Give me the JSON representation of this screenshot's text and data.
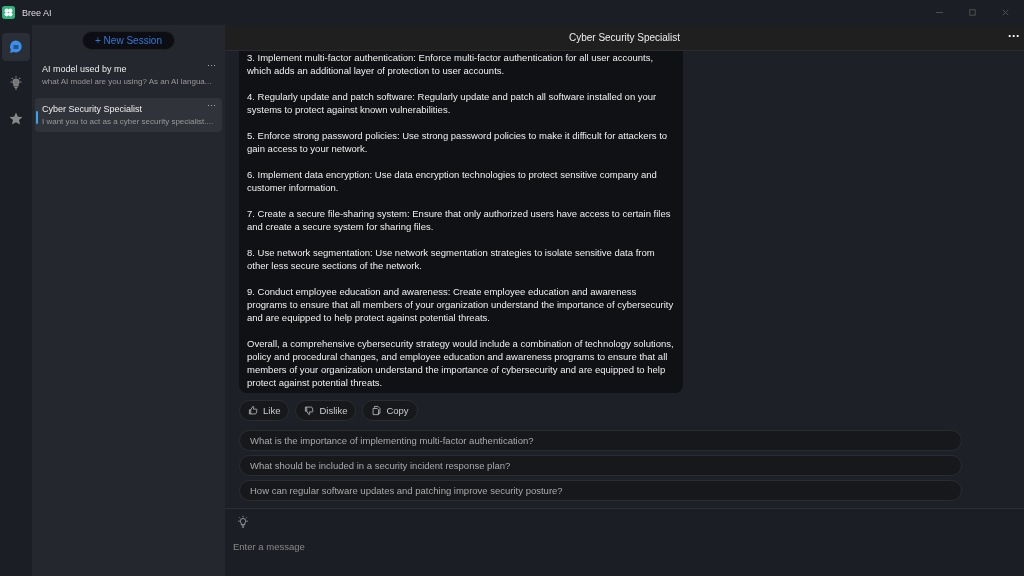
{
  "window": {
    "title": "Bree AI"
  },
  "rail": [
    {
      "kind": "chat",
      "selected": true
    },
    {
      "kind": "bulb",
      "selected": false
    },
    {
      "kind": "star",
      "selected": false
    }
  ],
  "sidebar": {
    "new_session": "+ New Session",
    "sessions": [
      {
        "title": "AI model used by me",
        "preview": "what AI model are you using? As an AI langua...",
        "menu": "···",
        "selected": false
      },
      {
        "title": "Cyber Security Specialist",
        "preview": "I want you to act as a cyber security specialist....",
        "menu": "···",
        "selected": true
      }
    ]
  },
  "chat": {
    "title": "Cyber Security Specialist",
    "menu": "···",
    "message": {
      "paragraphs": [
        "3. Implement multi-factor authentication: Enforce multi-factor authentication for all user accounts, which adds an additional layer of protection to user accounts.",
        "4. Regularly update and patch software: Regularly update and patch all software installed on your systems to protect against known vulnerabilities.",
        "5. Enforce strong password policies: Use strong password policies to make it difficult for attackers to gain access to your network.",
        "6. Implement data encryption: Use data encryption technologies to protect sensitive company and customer information.",
        "7. Create a secure file-sharing system: Ensure that only authorized users have access to certain files and create a secure system for sharing files.",
        "8. Use network segmentation: Use network segmentation strategies to isolate sensitive data from other less secure sections of the network.",
        "9. Conduct employee education and awareness: Create employee education and awareness programs to ensure that all members of your organization understand the importance of cybersecurity and are equipped to help protect against potential threats.",
        "Overall, a comprehensive cybersecurity strategy would include a combination of technology solutions, policy and procedural changes, and employee education and awareness programs to ensure that all members of your organization understand the importance of cybersecurity and are equipped to help protect against potential threats."
      ]
    },
    "actions": [
      {
        "kind": "like",
        "label": "Like"
      },
      {
        "kind": "dislike",
        "label": "Dislike"
      },
      {
        "kind": "copy",
        "label": "Copy"
      }
    ],
    "suggestions": [
      "What is the importance of implementing multi-factor authentication?",
      "What should be included in a security incident response plan?",
      "How can regular software updates and patching improve security posture?"
    ],
    "input": {
      "placeholder": "Enter a message"
    }
  }
}
